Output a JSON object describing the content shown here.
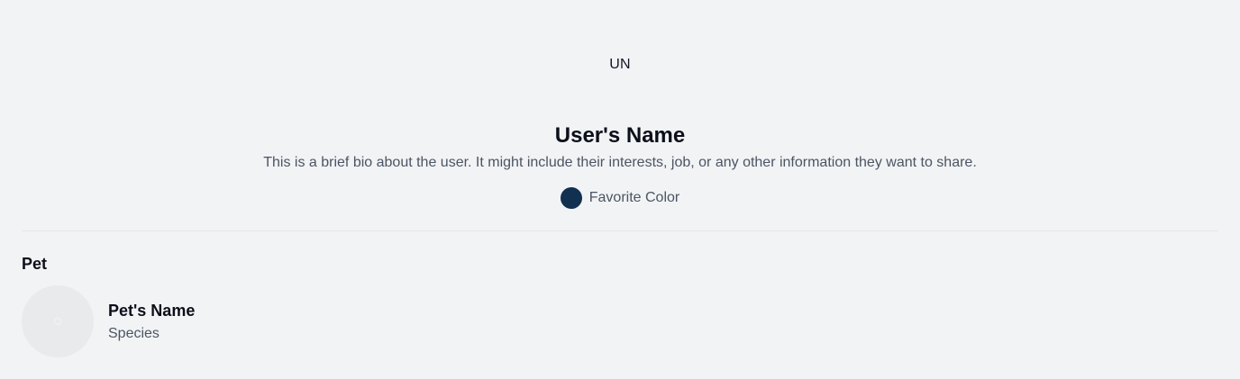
{
  "profile": {
    "avatar_initials": "UN",
    "name": "User's Name",
    "bio": "This is a brief bio about the user. It might include their interests, job, or any other information they want to share.",
    "favorite_color": {
      "label": "Favorite Color",
      "color": "#12304f"
    }
  },
  "pet_section": {
    "heading": "Pet",
    "pet": {
      "name": "Pet's Name",
      "species": "Species",
      "photo_icon": "image-placeholder-icon"
    }
  },
  "colors": {
    "background": "#f2f3f5",
    "divider": "#e5e7eb",
    "muted_text": "#4b5563",
    "pet_photo_bg": "#e9eaec"
  }
}
